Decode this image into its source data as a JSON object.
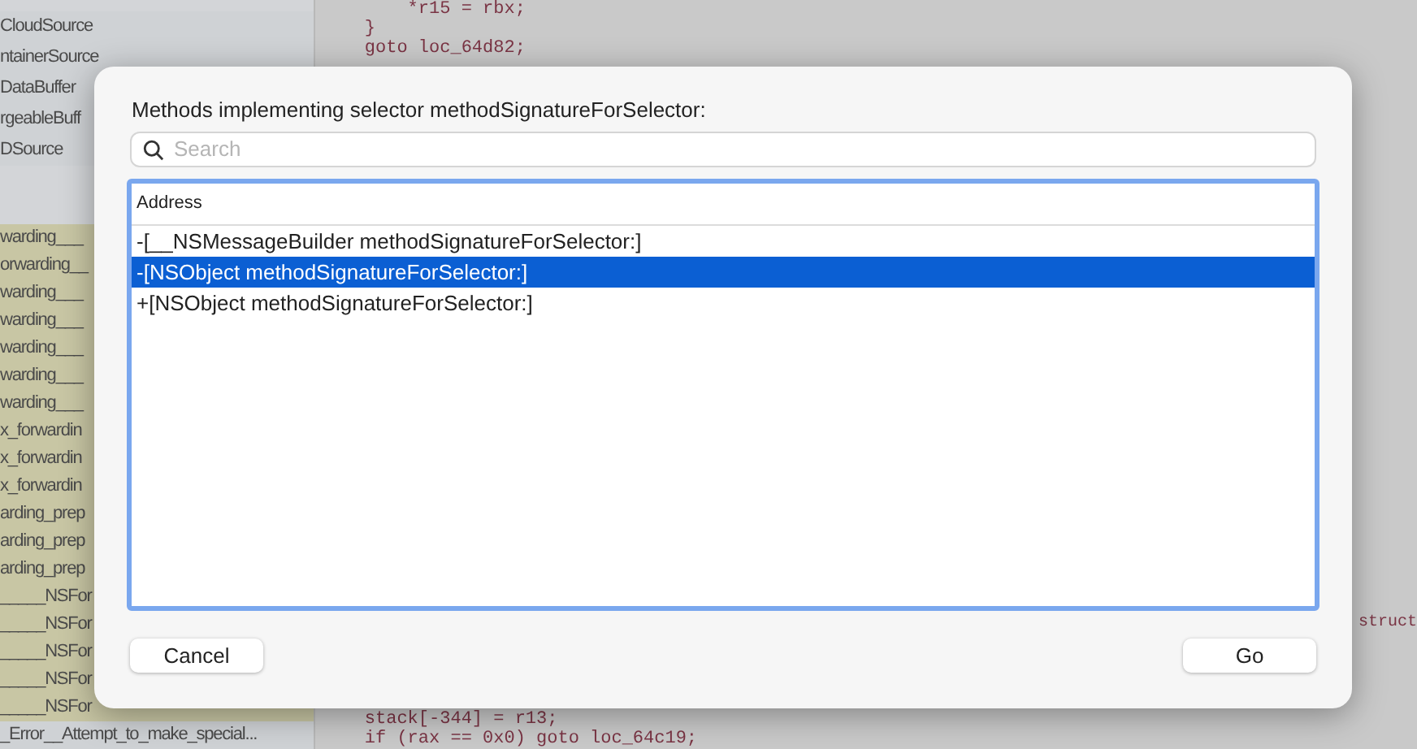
{
  "sidebar": {
    "items": [
      {
        "label": "CloudSource",
        "highlighted": false
      },
      {
        "label": "ntainerSource",
        "highlighted": false
      },
      {
        "label": "DataBuffer",
        "highlighted": false
      },
      {
        "label": "rgeableBuff",
        "highlighted": false
      },
      {
        "label": "DSource",
        "highlighted": false
      },
      {
        "label": "warding___",
        "highlighted": true
      },
      {
        "label": "orwarding__",
        "highlighted": true
      },
      {
        "label": "warding___",
        "highlighted": true
      },
      {
        "label": "warding___",
        "highlighted": true
      },
      {
        "label": "warding___",
        "highlighted": true
      },
      {
        "label": "warding___",
        "highlighted": true
      },
      {
        "label": "warding___",
        "highlighted": true
      },
      {
        "label": "x_forwardin",
        "highlighted": true
      },
      {
        "label": "x_forwardin",
        "highlighted": true
      },
      {
        "label": "x_forwardin",
        "highlighted": true
      },
      {
        "label": "arding_prep",
        "highlighted": true
      },
      {
        "label": "arding_prep",
        "highlighted": true
      },
      {
        "label": "arding_prep",
        "highlighted": true
      },
      {
        "label": "_____NSFor",
        "highlighted": true
      },
      {
        "label": "_____NSFor",
        "highlighted": true
      },
      {
        "label": "_____NSFor",
        "highlighted": true
      },
      {
        "label": "_____NSFor",
        "highlighted": true
      },
      {
        "label": "_____NSFor",
        "highlighted": true
      },
      {
        "label": "_Error__Attempt_to_make_special...",
        "highlighted": false
      }
    ]
  },
  "code": {
    "top_lines": [
      "        *r15 = rbx;",
      "    }",
      "    goto loc_64d82;"
    ],
    "side_line": "struct",
    "bottom_lines": [
      "    stack[-344] = r13;",
      "    if (rax == 0x0) goto loc_64c19;"
    ]
  },
  "dialog": {
    "title": "Methods implementing selector methodSignatureForSelector:",
    "search": {
      "placeholder": "Search"
    },
    "column": "Address",
    "rows": [
      {
        "label": "-[__NSMessageBuilder methodSignatureForSelector:]",
        "selected": false
      },
      {
        "label": "-[NSObject methodSignatureForSelector:]",
        "selected": true
      },
      {
        "label": "+[NSObject methodSignatureForSelector:]",
        "selected": false
      }
    ],
    "buttons": [
      "Cancel",
      "Go"
    ]
  }
}
